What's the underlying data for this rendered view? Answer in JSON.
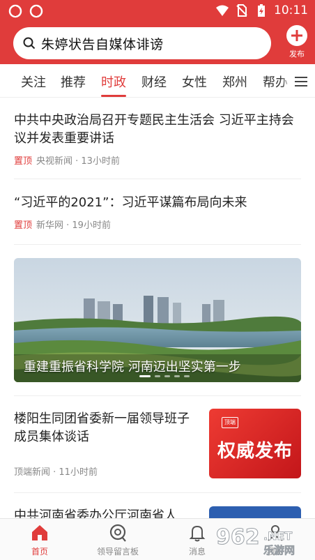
{
  "status_bar": {
    "time": "10:11",
    "icons": [
      "app-notification-icon",
      "app-notification-icon",
      "wifi-icon",
      "no-sim-icon",
      "battery-charging-icon"
    ]
  },
  "header": {
    "search_query": "朱婷状告自媒体诽谤",
    "publish_label": "发布"
  },
  "tabs": [
    {
      "label": "关注",
      "active": false
    },
    {
      "label": "推荐",
      "active": false
    },
    {
      "label": "时政",
      "active": true
    },
    {
      "label": "财经",
      "active": false
    },
    {
      "label": "女性",
      "active": false
    },
    {
      "label": "郑州",
      "active": false
    },
    {
      "label": "帮办",
      "active": false
    }
  ],
  "feed": [
    {
      "title": "中共中央政治局召开专题民主生活会 习近平主持会议并发表重要讲话",
      "pinned": "置顶",
      "source": "央视新闻 · 13小时前"
    },
    {
      "title": "“习近平的2021”：习近平谋篇布局向未来",
      "pinned": "置顶",
      "source": "新华网 · 19小时前"
    }
  ],
  "banner": {
    "caption": "重建重振省科学院 河南迈出坚实第一步",
    "active_dot": 0,
    "dot_count": 5
  },
  "feed_thumb": [
    {
      "title": "楼阳生同团省委新一届领导班子成员集体谈话",
      "source": "顶端新闻 · 11小时前",
      "thumb_text": "权威发布",
      "thumb_tag": "顶端"
    },
    {
      "title": "中共河南省委办公厅河南省人"
    }
  ],
  "bottom_nav": [
    {
      "label": "首页",
      "icon": "home-icon",
      "active": true
    },
    {
      "label": "领导留言板",
      "icon": "message-board-icon",
      "active": false
    },
    {
      "label": "消息",
      "icon": "bell-icon",
      "active": false
    },
    {
      "label": "我的",
      "icon": "user-icon",
      "active": false
    }
  ],
  "watermark": {
    "text": "乐游网",
    "brand": "962.NET"
  },
  "colors": {
    "brand_red": "#e03c3b",
    "text": "#222222",
    "meta": "#888888"
  }
}
